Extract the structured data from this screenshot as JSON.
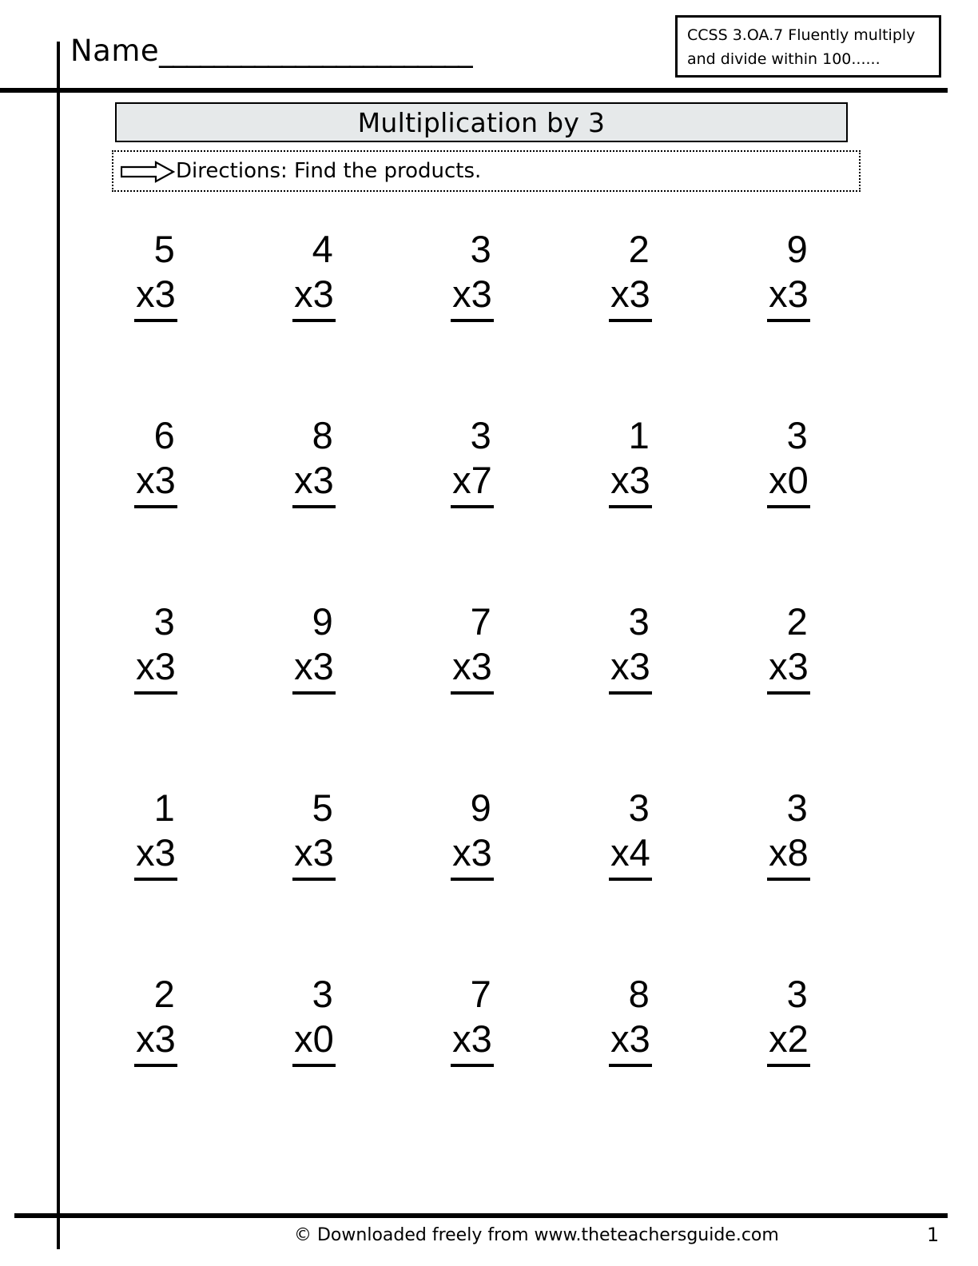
{
  "header": {
    "name_label": "Name",
    "name_blank": "_______________________",
    "standard_box": {
      "line1": "CCSS 3.OA.7 Fluently multiply",
      "line2": "and divide   within 100......"
    }
  },
  "title": {
    "text": "Multiplication by 3",
    "fill_color": "#E6E9EA",
    "border_color": "#000000"
  },
  "directions": {
    "icon": "right-arrow-icon",
    "text": "Directions: Find the products."
  },
  "worksheet": {
    "rows": [
      [
        {
          "top": "5",
          "bottom": "x3"
        },
        {
          "top": "4",
          "bottom": "x3"
        },
        {
          "top": "3",
          "bottom": "x3"
        },
        {
          "top": "2",
          "bottom": "x3"
        },
        {
          "top": "9",
          "bottom": "x3"
        }
      ],
      [
        {
          "top": "6",
          "bottom": "x3"
        },
        {
          "top": "8",
          "bottom": "x3"
        },
        {
          "top": "3",
          "bottom": "x7"
        },
        {
          "top": "1",
          "bottom": "x3"
        },
        {
          "top": "3",
          "bottom": "x0"
        }
      ],
      [
        {
          "top": "3",
          "bottom": "x3"
        },
        {
          "top": "9",
          "bottom": "x3"
        },
        {
          "top": "7",
          "bottom": "x3"
        },
        {
          "top": "3",
          "bottom": "x3"
        },
        {
          "top": "2",
          "bottom": "x3"
        }
      ],
      [
        {
          "top": "1",
          "bottom": "x3"
        },
        {
          "top": "5",
          "bottom": "x3"
        },
        {
          "top": "9",
          "bottom": "x3"
        },
        {
          "top": "3",
          "bottom": "x4"
        },
        {
          "top": "3",
          "bottom": "x8"
        }
      ],
      [
        {
          "top": "2",
          "bottom": "x3"
        },
        {
          "top": "3",
          "bottom": "x0"
        },
        {
          "top": "7",
          "bottom": "x3"
        },
        {
          "top": "8",
          "bottom": "x3"
        },
        {
          "top": "3",
          "bottom": "x2"
        }
      ]
    ]
  },
  "footer": {
    "credit": "© Downloaded freely from www.theteachersguide.com",
    "page_number": "1"
  }
}
